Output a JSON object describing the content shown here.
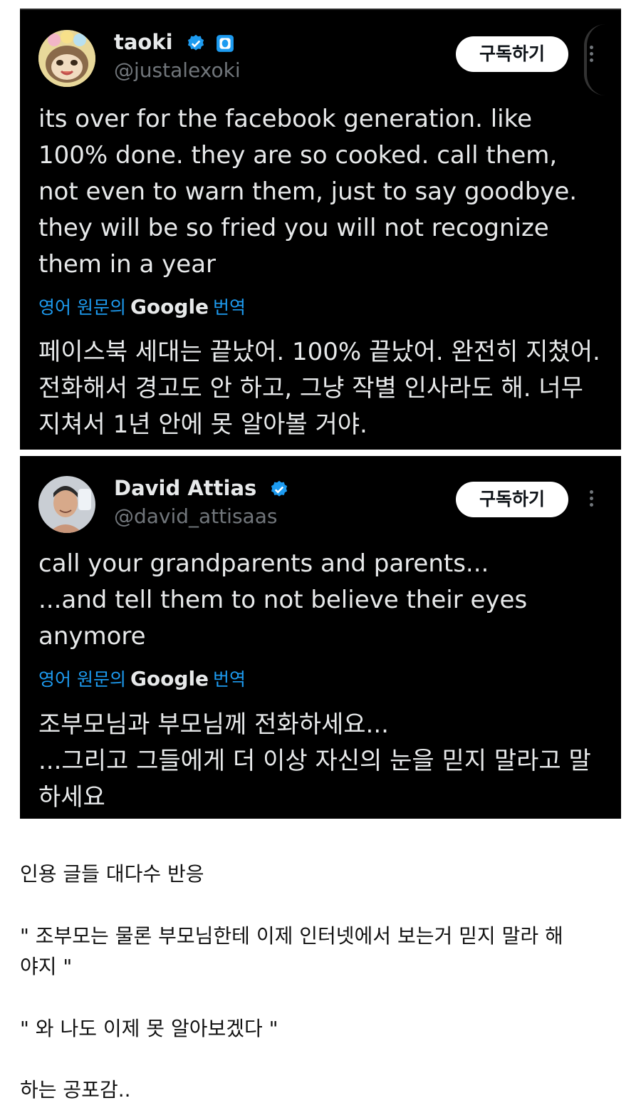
{
  "tweets": [
    {
      "name": "taoki",
      "handle": "@justalexoki",
      "subscribe_label": "구독하기",
      "text": "its over for the facebook generation. like 100% done. they are so cooked. call them, not even to warn them, just to say goodbye. they will be so fried you will not recognize them in a year",
      "translate_prefix": "영어 원문의",
      "translate_brand": "Google",
      "translate_suffix": "번역",
      "translated_text": "페이스북 세대는 끝났어. 100% 끝났어. 완전히 지쳤어. 전화해서 경고도 안 하고, 그냥 작별 인사라도 해. 너무 지쳐서 1년 안에 못 알아볼 거야."
    },
    {
      "name": "David Attias",
      "handle": "@david_attisaas",
      "subscribe_label": "구독하기",
      "text_lines": [
        "call your grandparents and parents...",
        "...and tell them to not believe their eyes anymore"
      ],
      "translate_prefix": "영어 원문의",
      "translate_brand": "Google",
      "translate_suffix": "번역",
      "translated_lines": [
        "조부모님과 부모님께 전화하세요...",
        "...그리고 그들에게 더 이상 자신의 눈을 믿지 말라고 말하세요"
      ]
    }
  ],
  "comments": [
    "인용 글들 대다수 반응",
    "\" 조부모는 물론 부모님한테 이제 인터넷에서 보는거 믿지 말라 해",
    "야지 \"",
    "\" 와 나도 이제  못 알아보겠다 \"",
    "하는 공포감.."
  ],
  "colors": {
    "background": "#000000",
    "link": "#1d9bf0",
    "verified": "#1d9bf0",
    "muted": "#71767b"
  }
}
